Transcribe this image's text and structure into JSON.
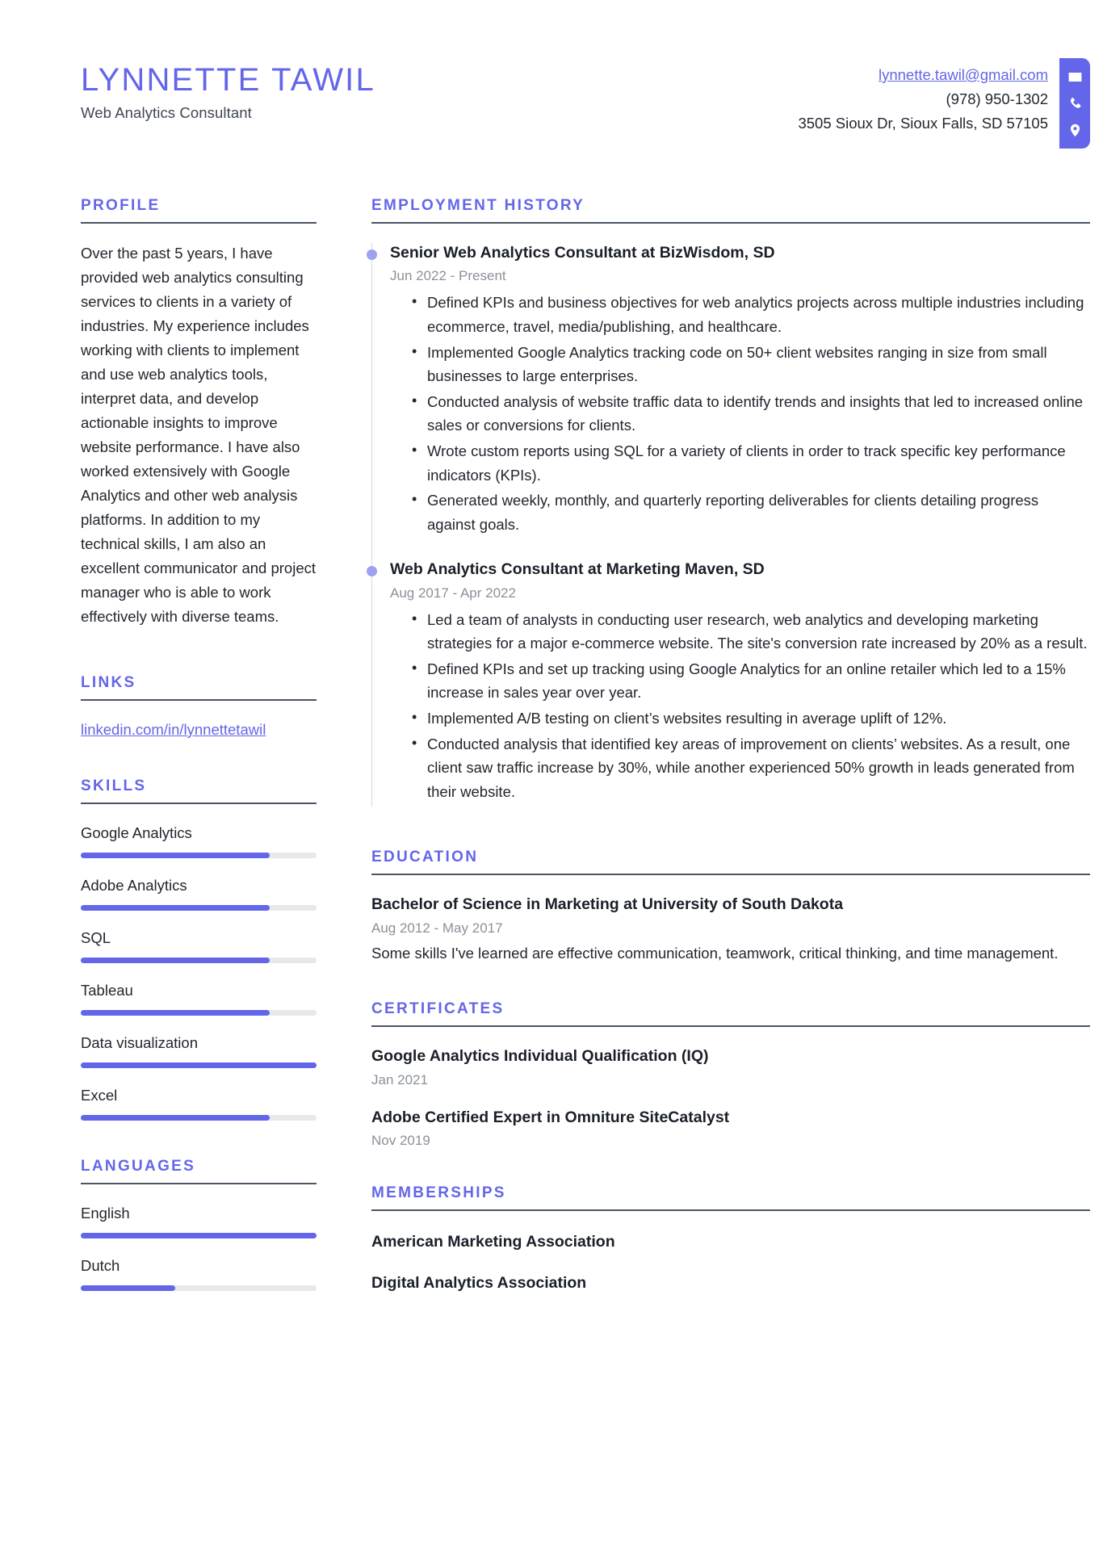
{
  "theme": {
    "accent": "#6366e8",
    "rule": "#4b5563",
    "muted": "#8b9099",
    "track": "#e7e8ea",
    "dot": "#9ea1ee"
  },
  "header": {
    "full_name": "LYNNETTE TAWIL",
    "job_title": "Web Analytics Consultant",
    "contact": {
      "email": "lynnette.tawil@gmail.com",
      "phone": "(978) 950-1302",
      "address": "3505 Sioux Dr, Sioux Falls, SD 57105"
    },
    "icons": [
      "envelope-icon",
      "phone-icon",
      "location-pin-icon"
    ]
  },
  "sidebar": {
    "profile": {
      "title": "PROFILE",
      "text": "Over the past 5 years, I have provided web analytics consulting services to clients in a variety of industries. My experience includes working with clients to implement and use web analytics tools, interpret data, and develop actionable insights to improve website performance. I have also worked extensively with Google Analytics and other web analysis platforms. In addition to my technical skills, I am also an excellent communicator and project manager who is able to work effectively with diverse teams."
    },
    "links": {
      "title": "LINKS",
      "items": [
        {
          "label": "linkedin.com/in/lynnettetawil"
        }
      ]
    },
    "skills": {
      "title": "SKILLS",
      "items": [
        {
          "label": "Google Analytics",
          "level": 80
        },
        {
          "label": "Adobe Analytics",
          "level": 80
        },
        {
          "label": "SQL",
          "level": 80
        },
        {
          "label": "Tableau",
          "level": 80
        },
        {
          "label": "Data visualization",
          "level": 100
        },
        {
          "label": "Excel",
          "level": 80
        }
      ]
    },
    "languages": {
      "title": "LANGUAGES",
      "items": [
        {
          "label": "English",
          "level": 100
        },
        {
          "label": "Dutch",
          "level": 40
        }
      ]
    }
  },
  "main": {
    "employment": {
      "title": "EMPLOYMENT HISTORY",
      "jobs": [
        {
          "heading": "Senior Web Analytics Consultant at BizWisdom, SD",
          "date": "Jun 2022 - Present",
          "bullets": [
            "Defined KPIs and business objectives for web analytics projects across multiple industries including ecommerce, travel, media/publishing, and healthcare.",
            "Implemented Google Analytics tracking code on 50+ client websites ranging in size from small businesses to large enterprises.",
            "Conducted analysis of website traffic data to identify trends and insights that led to increased online sales or conversions for clients.",
            "Wrote custom reports using SQL for a variety of clients in order to track specific key performance indicators (KPIs).",
            "Generated weekly, monthly, and quarterly reporting deliverables for clients detailing progress against goals."
          ]
        },
        {
          "heading": "Web Analytics Consultant at Marketing Maven, SD",
          "date": "Aug 2017 - Apr 2022",
          "bullets": [
            "Led a team of analysts in conducting user research, web analytics and developing marketing strategies for a major e-commerce website. The site's conversion rate increased by 20% as a result.",
            "Defined KPIs and set up tracking using Google Analytics for an online retailer which led to a 15% increase in sales year over year.",
            "Implemented A/B testing on client’s websites resulting in average uplift of 12%.",
            "Conducted analysis that identified key areas of improvement on clients’ websites. As a result, one client saw traffic increase by 30%, while another experienced 50% growth in leads generated from their website."
          ]
        }
      ]
    },
    "education": {
      "title": "EDUCATION",
      "entries": [
        {
          "heading": "Bachelor of Science in Marketing at University of South Dakota",
          "date": "Aug 2012 - May 2017",
          "description": "Some skills I've learned are effective communication, teamwork, critical thinking, and time management."
        }
      ]
    },
    "certificates": {
      "title": "CERTIFICATES",
      "entries": [
        {
          "heading": "Google Analytics Individual Qualification (IQ)",
          "date": "Jan 2021"
        },
        {
          "heading": "Adobe Certified Expert in Omniture SiteCatalyst",
          "date": "Nov 2019"
        }
      ]
    },
    "memberships": {
      "title": "MEMBERSHIPS",
      "entries": [
        {
          "heading": "American Marketing Association"
        },
        {
          "heading": "Digital Analytics Association"
        }
      ]
    }
  }
}
